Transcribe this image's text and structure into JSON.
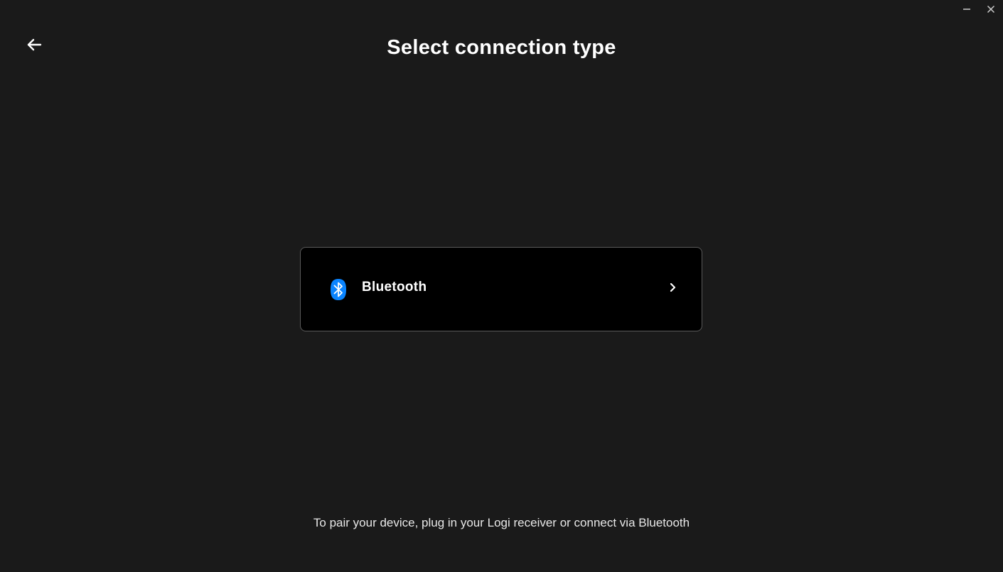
{
  "window": {
    "controls": {
      "minimize_icon": "minimize-icon",
      "close_icon": "close-icon"
    }
  },
  "header": {
    "back_icon": "arrow-left-icon",
    "title": "Select connection type"
  },
  "options": [
    {
      "label": "Bluetooth",
      "icon": "bluetooth-icon",
      "chevron_icon": "chevron-right-icon"
    }
  ],
  "footer": {
    "hint": "To pair your device, plug in your Logi receiver or connect via Bluetooth"
  },
  "colors": {
    "background": "#1a1a1a",
    "card_background": "#000000",
    "card_border": "#5a5a5a",
    "bluetooth_blue": "#0a84ff",
    "text": "#ffffff"
  }
}
